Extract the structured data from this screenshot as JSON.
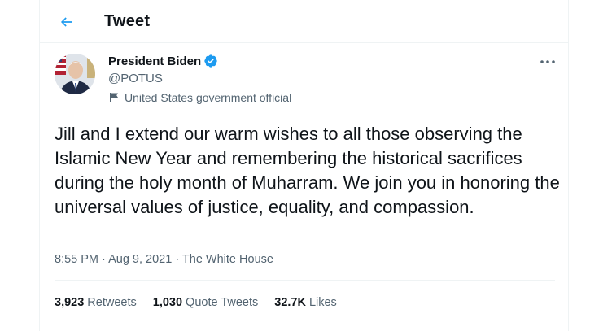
{
  "header": {
    "title": "Tweet",
    "back_icon": "arrow-left-icon"
  },
  "author": {
    "name": "President Biden",
    "handle": "@POTUS",
    "verified_icon": "verified-badge-icon",
    "label": "United States government official",
    "label_icon": "flag-icon"
  },
  "tweet": {
    "text": "Jill and I extend our warm wishes to all those observing the Islamic New Year and remembering the historical sacrifices during the holy month of Muharram. We join you in honoring the universal values of justice, equality, and compassion.",
    "time": "8:55 PM · Aug 9, 2021 · ",
    "source": "The White House"
  },
  "stats": {
    "retweets_count": "3,923",
    "retweets_label": "Retweets",
    "quotes_count": "1,030",
    "quotes_label": "Quote Tweets",
    "likes_count": "32.7K",
    "likes_label": "Likes"
  },
  "colors": {
    "accent": "#1d9bf0",
    "text": "#0f1419",
    "secondary": "#536471",
    "border": "#eff3f4"
  }
}
